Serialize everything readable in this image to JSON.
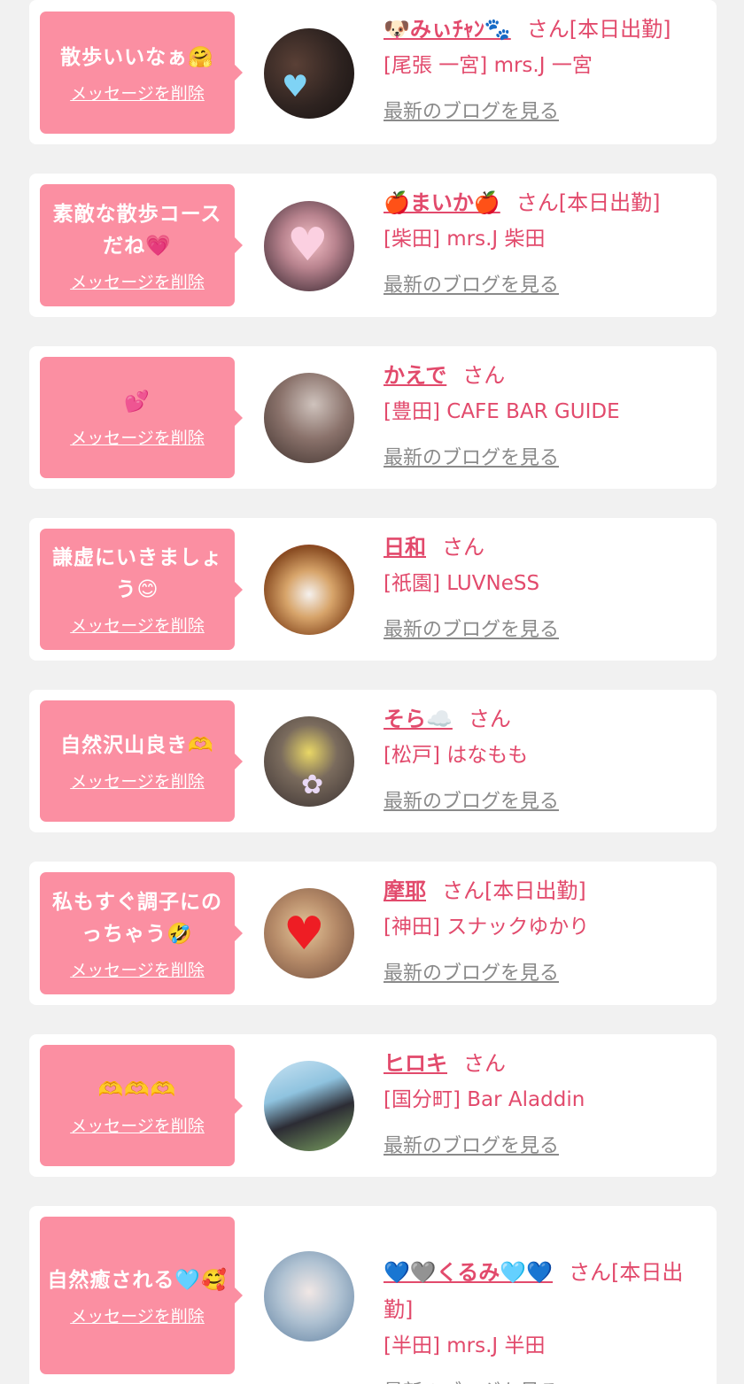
{
  "cards": [
    {
      "message": "散歩いいなぁ🤗",
      "delete_label": "メッセージを削除",
      "name": "🐶みぃﾁｬﾝ🐾",
      "honorific": "さん[本日出勤]",
      "shop": "[尾張 一宮] mrs.J 一宮",
      "blog_label": "最新のブログを見る",
      "avatar_icon": "heart-sticker-blue"
    },
    {
      "message": "素敵な散歩コース\nだね💗",
      "delete_label": "メッセージを削除",
      "name": "🍎まいか🍎",
      "honorific": "さん[本日出勤]",
      "shop": "[柴田] mrs.J 柴田",
      "blog_label": "最新のブログを見る",
      "avatar_icon": "heart-sticker-pink"
    },
    {
      "message": "💕",
      "delete_label": "メッセージを削除",
      "name": "かえで",
      "honorific": "さん",
      "shop": "[豊田] CAFE BAR GUIDE",
      "blog_label": "最新のブログを見る",
      "avatar_icon": ""
    },
    {
      "message": "謙虚にいきましょ\nう😊",
      "delete_label": "メッセージを削除",
      "name": "日和",
      "honorific": "さん",
      "shop": "[祇園] LUVNeSS",
      "blog_label": "最新のブログを見る",
      "avatar_icon": "dog-photo"
    },
    {
      "message": "自然沢山良き🫶",
      "delete_label": "メッセージを削除",
      "name": "そら☁️",
      "honorific": "さん",
      "shop": "[松戸] はなもも",
      "blog_label": "最新のブログを見る",
      "avatar_icon": "paw-sticker"
    },
    {
      "message": "私もすぐ調子にの\nっちゃう🤣",
      "delete_label": "メッセージを削除",
      "name": "摩耶",
      "honorific": "さん[本日出勤]",
      "shop": "[神田] スナックゆかり",
      "blog_label": "最新のブログを見る",
      "avatar_icon": "heart-sticker-red"
    },
    {
      "message": "🫶🫶🫶",
      "delete_label": "メッセージを削除",
      "name": "ヒロキ",
      "honorific": "さん",
      "shop": "[国分町] Bar Aladdin",
      "blog_label": "最新のブログを見る",
      "avatar_icon": ""
    },
    {
      "message": "自然癒される🩵🥰",
      "delete_label": "メッセージを削除",
      "name": "💙🩶くるみ🩵💙",
      "honorific": "さん[本日出\n勤]",
      "shop": "[半田] mrs.J 半田",
      "blog_label": "最新のブログを見る",
      "avatar_icon": ""
    }
  ],
  "colors": {
    "page_bg": "#f1f1f1",
    "card_bg": "#ffffff",
    "bubble_bg": "#fb8fa2",
    "accent": "#e24a6c",
    "link_gray": "#8a8a8a"
  }
}
